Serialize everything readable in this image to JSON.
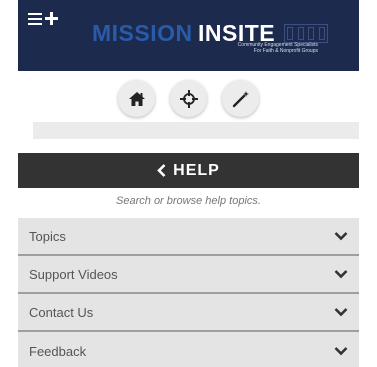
{
  "header": {
    "logo_primary": "MISSION",
    "logo_secondary": "INSITE",
    "tagline_line1": "Community Engagement Specialists",
    "tagline_line2": "For Faith & Nonprofit Groups",
    "background": "#1c2a4e"
  },
  "toolbar": {
    "buttons": [
      {
        "icon": "home-icon"
      },
      {
        "icon": "crosshair-icon"
      },
      {
        "icon": "magic-wand-icon"
      }
    ]
  },
  "help": {
    "title": "HELP",
    "hint": "Search or browse help topics."
  },
  "accordion": {
    "items": [
      {
        "label": "Topics"
      },
      {
        "label": "Support Videos"
      },
      {
        "label": "Contact Us"
      },
      {
        "label": "Feedback"
      }
    ]
  }
}
